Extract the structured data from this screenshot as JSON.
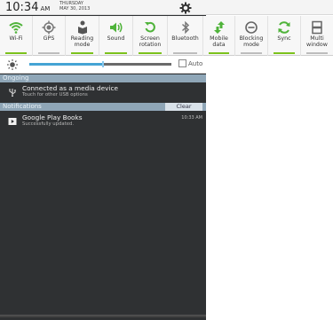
{
  "status": {
    "time": "10:34",
    "ampm": "AM",
    "day": "THURSDAY",
    "date": "MAY 30, 2013"
  },
  "toggles": [
    {
      "label": "Wi-Fi",
      "on": true,
      "icon": "wifi-icon"
    },
    {
      "label": "GPS",
      "on": false,
      "icon": "gps-icon"
    },
    {
      "label": "Reading mode",
      "on": true,
      "icon": "reading-mode-icon"
    },
    {
      "label": "Sound",
      "on": true,
      "icon": "sound-icon"
    },
    {
      "label": "Screen rotation",
      "on": true,
      "icon": "screen-rotation-icon"
    },
    {
      "label": "Bluetooth",
      "on": false,
      "icon": "bluetooth-icon"
    },
    {
      "label": "Mobile data",
      "on": true,
      "icon": "mobile-data-icon"
    },
    {
      "label": "Blocking mode",
      "on": false,
      "icon": "blocking-mode-icon"
    },
    {
      "label": "Sync",
      "on": true,
      "icon": "sync-icon"
    },
    {
      "label": "Multi window",
      "on": false,
      "icon": "multi-window-icon"
    }
  ],
  "brightness": {
    "level": 0.52,
    "auto_label": "Auto",
    "auto_checked": false
  },
  "ongoing": {
    "header": "Ongoing",
    "title": "Connected as a media device",
    "subtitle": "Touch for other USB options"
  },
  "notifications": {
    "header": "Notifications",
    "clear_label": "Clear",
    "item": {
      "title": "Google Play Books",
      "subtitle": "Successfully updated.",
      "time": "10:33 AM"
    }
  },
  "colors": {
    "accent_on": "#7cc21c",
    "accent_icon": "#4fb33a",
    "panel": "#2f3133",
    "section": "#8fa6b7"
  }
}
